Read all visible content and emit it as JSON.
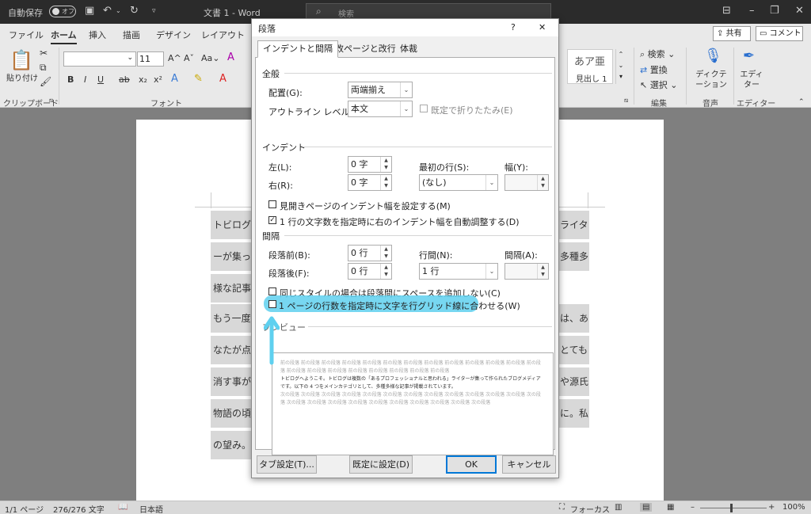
{
  "titlebar": {
    "autosave_label": "自動保存",
    "autosave_state": "オフ",
    "doc_title": "文書 1  -  Word",
    "search_placeholder": "検索"
  },
  "ribbon": {
    "tabs": [
      "ファイル",
      "ホーム",
      "挿入",
      "描画",
      "デザイン",
      "レイアウト"
    ],
    "active_tab": "ホーム",
    "share_label": "共有",
    "comment_label": "コメント",
    "paste_label": "貼り付け",
    "font_size": "11",
    "style_preview_glyph": "あア亜",
    "style_name": "見出し 1",
    "find_label": "検索",
    "replace_label": "置換",
    "select_label": "選択",
    "dictation_label": "ディクテーション",
    "editor_label": "エディター",
    "groups": {
      "clipboard": "クリップボード",
      "font": "フォント",
      "editing": "編集",
      "voice": "音声",
      "editor": "エディター"
    }
  },
  "document": {
    "lines": [
      {
        "left": "トビログ",
        "right": "ライタ"
      },
      {
        "left": "ーが集っ",
        "right": "多種多"
      },
      {
        "left": "様な記事",
        "right": ""
      },
      {
        "left": "もう一度",
        "right": "は、あ"
      },
      {
        "left": "なたが点",
        "right": "とても"
      },
      {
        "left": "消す事が",
        "right": "や源氏"
      },
      {
        "left": "物語の頃",
        "right": "に。私"
      },
      {
        "left": "の望み。",
        "right": ""
      }
    ]
  },
  "dialog": {
    "title": "段落",
    "help": "?",
    "close": "✕",
    "tabs": [
      "インデントと間隔",
      "改ページと改行",
      "体裁"
    ],
    "general": {
      "heading": "全般",
      "alignment_label": "配置(G):",
      "alignment_value": "両端揃え",
      "outline_label": "アウトライン レベル(O):",
      "outline_value": "本文",
      "collapse_label": "既定で折りたたみ(E)"
    },
    "indent": {
      "heading": "インデント",
      "left_label": "左(L):",
      "left_value": "0 字",
      "right_label": "右(R):",
      "right_value": "0 字",
      "first_line_label": "最初の行(S):",
      "first_line_value": "(なし)",
      "width_label": "幅(Y):",
      "mirror_label": "見開きページのインデント幅を設定する(M)",
      "auto_adjust_label": "1 行の文字数を指定時に右のインデント幅を自動調整する(D)"
    },
    "spacing": {
      "heading": "間隔",
      "before_label": "段落前(B):",
      "before_value": "0 行",
      "after_label": "段落後(F):",
      "after_value": "0 行",
      "line_label": "行間(N):",
      "line_value": "1 行",
      "at_label": "間隔(A):",
      "no_space_label": "同じスタイルの場合は段落間にスペースを追加しない(C)",
      "grid_label": "1 ページの行数を指定時に文字を行グリッド線に合わせる(W)"
    },
    "preview": {
      "heading": "プレビュー",
      "prev_text": "前の段落 前の段落 前の段落 前の段落 前の段落 前の段落 前の段落 前の段落 前の段落 前の段落 前の段落 前の段落 前の段落 前の段落 前の段落 前の段落 前の段落 前の段落 前の段落 前の段落 前の段落",
      "current_text": "トビログへようこそ。トビログは複数の「あるプロフェッショナルと思われる」ライターが集って作られたブログメディアです。以下の 4 つをメインカテゴリとして、多種多様な記事が掲載されています。",
      "next_text": "次の段落 次の段落 次の段落 次の段落 次の段落 次の段落 次の段落 次の段落 次の段落 次の段落 次の段落 次の段落 次の段落 次の段落 次の段落 次の段落 次の段落 次の段落 次の段落 次の段落 次の段落 次の段落 次の段落"
    },
    "buttons": {
      "tabs": "タブ設定(T)...",
      "default": "既定に設定(D)",
      "ok": "OK",
      "cancel": "キャンセル"
    }
  },
  "statusbar": {
    "page": "1/1 ページ",
    "words": "276/276 文字",
    "language": "日本語",
    "focus": "フォーカス",
    "zoom": "100%"
  },
  "annotation": {
    "highlight_color": "#5fd0ef"
  }
}
